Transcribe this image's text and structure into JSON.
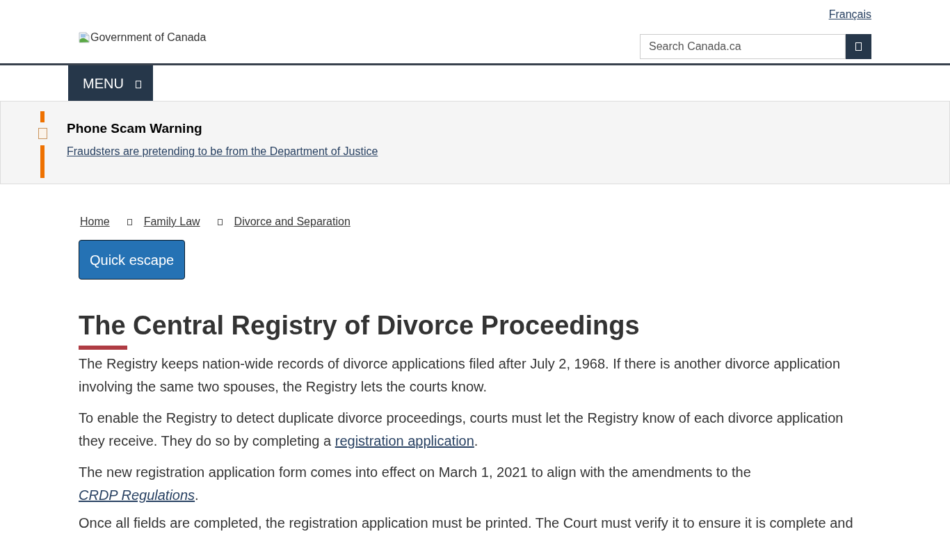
{
  "header": {
    "language_link": "Français",
    "logo": {
      "alt": "Government of Canada"
    },
    "search": {
      "placeholder": "Search Canada.ca"
    }
  },
  "menu": {
    "label": "MENU"
  },
  "alert": {
    "title": "Phone Scam Warning",
    "link": "Fraudsters are pretending to be from the Department of Justice"
  },
  "breadcrumbs": [
    {
      "label": "Home"
    },
    {
      "label": "Family Law"
    },
    {
      "label": "Divorce and Separation"
    }
  ],
  "quick_escape": {
    "label": "Quick escape"
  },
  "heading": "The Central Registry of Divorce Proceedings",
  "paragraphs": [
    {
      "parts": [
        {
          "kind": "text",
          "text": "The Registry keeps nation-wide records of divorce applications filed after July 2, 1968. If there is another divorce application involving the same two spouses, the Registry lets the courts know."
        }
      ]
    },
    {
      "parts": [
        {
          "kind": "text",
          "text": "To enable the Registry to detect duplicate divorce proceedings, courts must let the Registry know of each divorce application they receive. They do so by completing a "
        },
        {
          "kind": "link",
          "text": "registration application"
        },
        {
          "kind": "text",
          "text": "."
        }
      ]
    },
    {
      "parts": [
        {
          "kind": "text",
          "text": "The new registration application form comes into effect on March 1, 2021 to align with the amendments to the "
        },
        {
          "kind": "link",
          "text": "CRDP Regulations",
          "italic": true
        },
        {
          "kind": "text",
          "text": "."
        }
      ]
    },
    {
      "parts": [
        {
          "kind": "text",
          "text": "Once all fields are completed, the registration application must be printed. The Court must verify it to ensure it is complete and"
        }
      ]
    }
  ]
}
